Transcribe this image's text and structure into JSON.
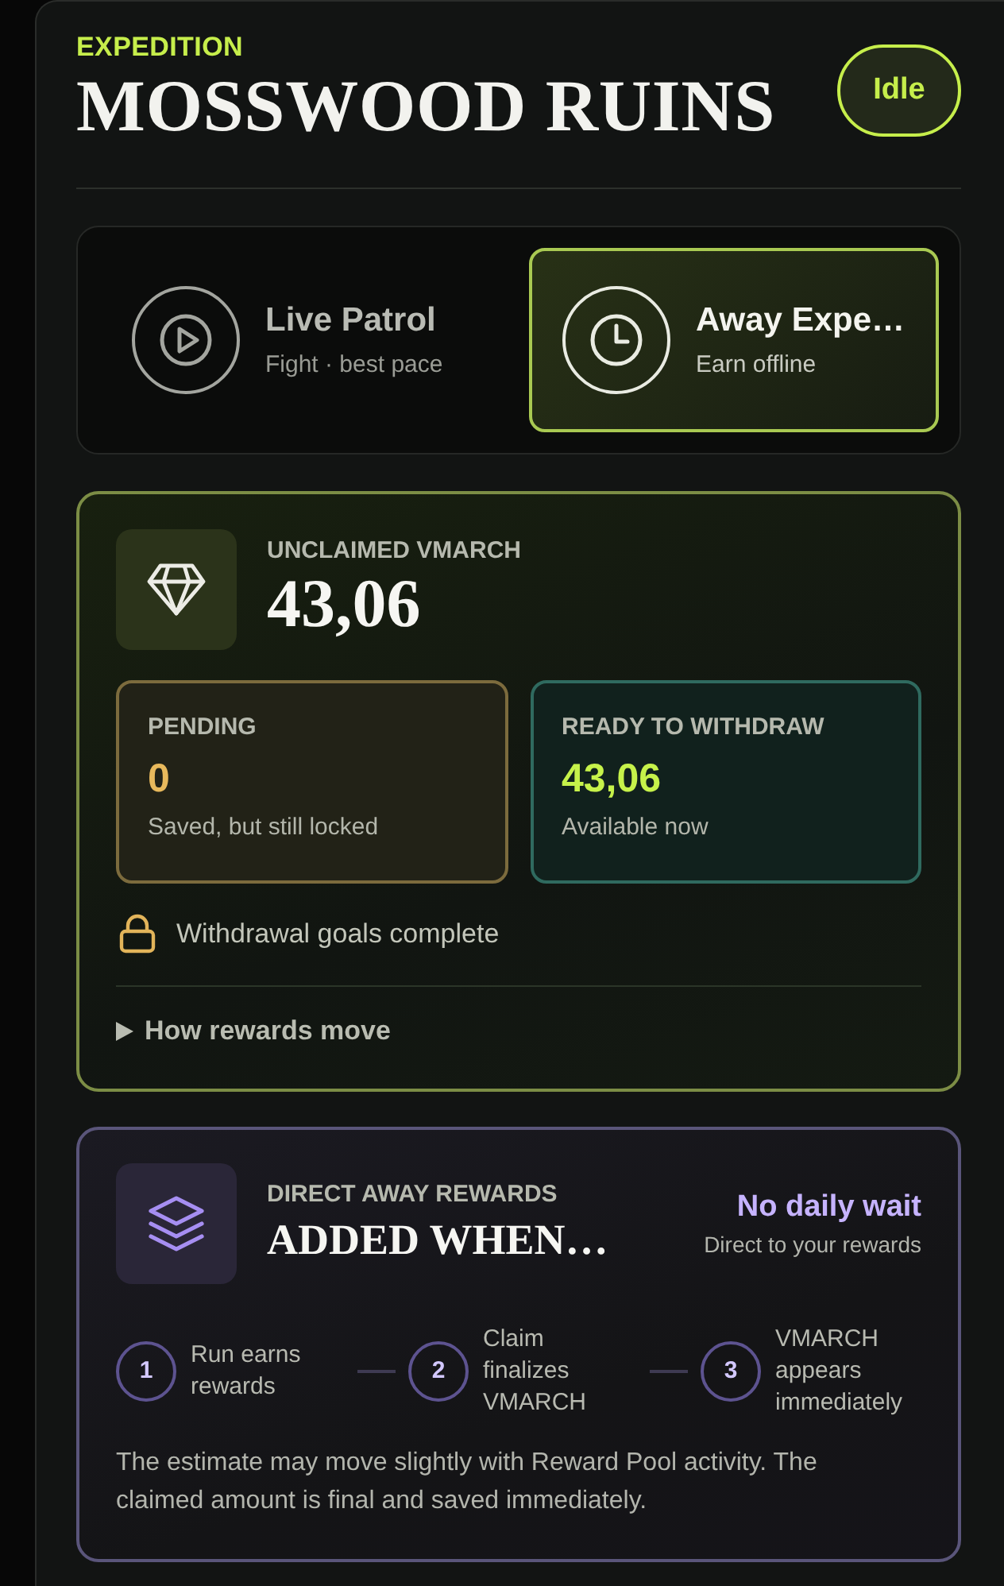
{
  "header": {
    "eyebrow": "EXPEDITION",
    "title": "MOSSWOOD RUINS",
    "status": "Idle"
  },
  "modes": [
    {
      "kind": "live",
      "title": "Live Patrol",
      "subtitle": "Fight · best pace",
      "selected": false
    },
    {
      "kind": "away",
      "title": "Away Expe…",
      "subtitle": "Earn offline",
      "selected": true
    }
  ],
  "rewards": {
    "label": "UNCLAIMED VMARCH",
    "amount": "43,06",
    "balances": [
      {
        "kind": "pending",
        "label": "PENDING",
        "value": "0",
        "note": "Saved, but still locked"
      },
      {
        "kind": "ready",
        "label": "READY TO WITHDRAW",
        "value": "43,06",
        "note": "Available now"
      }
    ],
    "goal": "Withdrawal goals complete",
    "details": {
      "label": "How rewards move",
      "expanded": false
    }
  },
  "direct": {
    "label": "DIRECT AWAY REWARDS",
    "title": "ADDED WHEN…",
    "badge": "No daily wait",
    "badge_note": "Direct to your rewards",
    "steps": [
      {
        "number": "1",
        "text": "Run earns rewards"
      },
      {
        "number": "2",
        "text": "Claim finalizes VMARCH"
      },
      {
        "number": "3",
        "text": "VMARCH appears immediately"
      }
    ],
    "note": "The estimate may move slightly with Reward Pool activity. The claimed amount is final and saved immediately."
  }
}
